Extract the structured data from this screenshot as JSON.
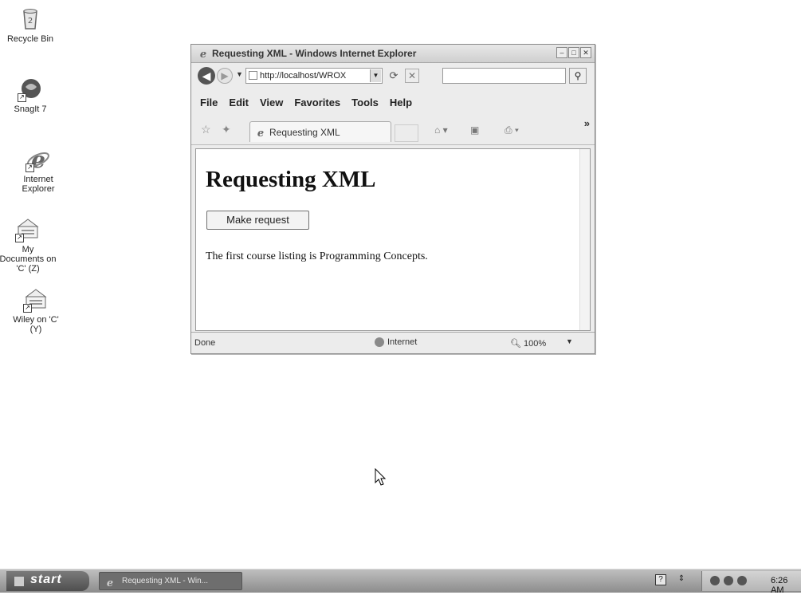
{
  "desktop": {
    "icons": [
      {
        "label": "Recycle Bin",
        "icon": "recycle-bin-icon"
      },
      {
        "label": "SnagIt 7",
        "icon": "snagit-icon"
      },
      {
        "label": "Internet Explorer",
        "icon": "internet-explorer-icon"
      },
      {
        "label": "My Documents on 'C' (Z)",
        "icon": "network-drive-icon"
      },
      {
        "label": "Wiley on 'C' (Y)",
        "icon": "network-drive-icon"
      }
    ]
  },
  "window": {
    "title": "Requesting XML - Windows Internet Explorer",
    "address": "http://localhost/WROX",
    "menu": [
      "File",
      "Edit",
      "View",
      "Favorites",
      "Tools",
      "Help"
    ],
    "tab_label": "Requesting XML",
    "chevron": "»",
    "page": {
      "heading": "Requesting XML",
      "button_label": "Make request",
      "paragraph": "The first course listing is Programming Concepts."
    },
    "status": {
      "text": "Done",
      "zone": "Internet",
      "zoom": "100%"
    }
  },
  "taskbar": {
    "start_label": "start",
    "task_label": "Requesting XML - Win...",
    "clock": "6:26 AM"
  }
}
